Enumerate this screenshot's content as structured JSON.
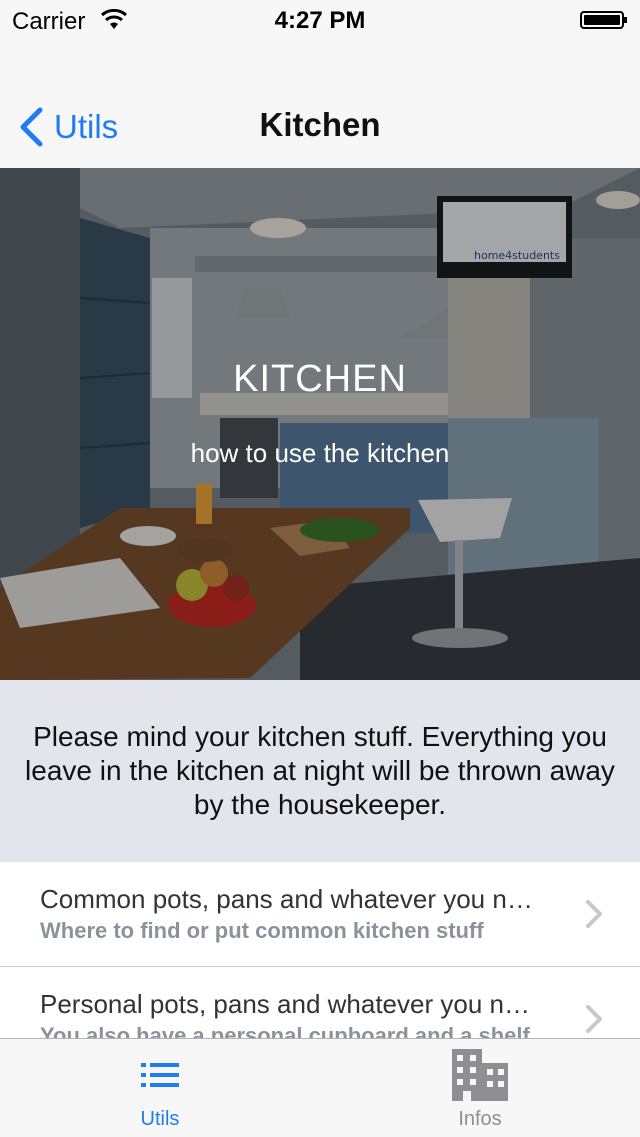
{
  "status_bar": {
    "carrier": "Carrier",
    "time": "4:27 PM"
  },
  "nav": {
    "back_label": "Utils",
    "title": "Kitchen"
  },
  "hero": {
    "title": "KITCHEN",
    "subtitle": "how to use the kitchen",
    "tv_logo": "home4students"
  },
  "notice": {
    "text": "Please mind your kitchen stuff. Everything you leave in the kitchen at night will be thrown away by the housekeeper."
  },
  "list": {
    "items": [
      {
        "title": "Common pots, pans and whatever you need",
        "subtitle": "Where to find or put common kitchen stuff"
      },
      {
        "title": "Personal pots, pans and whatever you need",
        "subtitle": "You also have a personal cupboard and a shelf"
      }
    ]
  },
  "tab_bar": {
    "tabs": [
      {
        "label": "Utils",
        "icon": "list-icon",
        "selected": true
      },
      {
        "label": "Infos",
        "icon": "building-icon",
        "selected": false
      }
    ]
  },
  "colors": {
    "accent": "#1f7cf5",
    "inactive": "#8e8e93",
    "notice_bg": "#e4e4ed"
  }
}
